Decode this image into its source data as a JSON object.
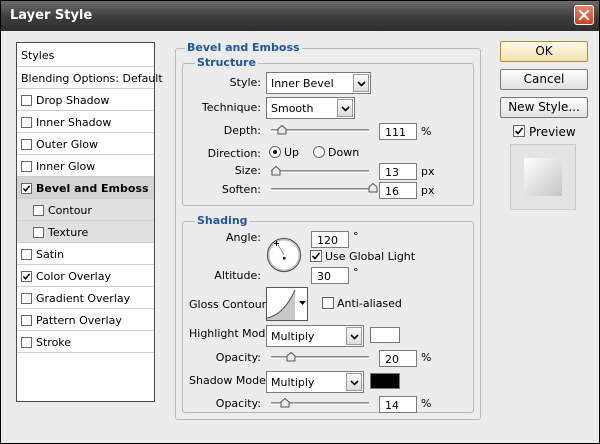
{
  "window": {
    "title": "Layer Style"
  },
  "styles_list": {
    "items": [
      {
        "label": "Styles",
        "has_checkbox": false,
        "checked": false,
        "bold": false
      },
      {
        "label": "Blending Options: Default",
        "has_checkbox": false,
        "checked": false,
        "bold": false
      },
      {
        "label": "Drop Shadow",
        "has_checkbox": true,
        "checked": false,
        "bold": false
      },
      {
        "label": "Inner Shadow",
        "has_checkbox": true,
        "checked": false,
        "bold": false
      },
      {
        "label": "Outer Glow",
        "has_checkbox": true,
        "checked": false,
        "bold": false
      },
      {
        "label": "Inner Glow",
        "has_checkbox": true,
        "checked": false,
        "bold": false
      },
      {
        "label": "Bevel and Emboss",
        "has_checkbox": true,
        "checked": true,
        "bold": true,
        "selected": true
      },
      {
        "label": "Contour",
        "has_checkbox": true,
        "checked": false,
        "bold": false,
        "sub": true
      },
      {
        "label": "Texture",
        "has_checkbox": true,
        "checked": false,
        "bold": false,
        "sub": true
      },
      {
        "label": "Satin",
        "has_checkbox": true,
        "checked": false,
        "bold": false
      },
      {
        "label": "Color Overlay",
        "has_checkbox": true,
        "checked": true,
        "bold": false
      },
      {
        "label": "Gradient Overlay",
        "has_checkbox": true,
        "checked": false,
        "bold": false
      },
      {
        "label": "Pattern Overlay",
        "has_checkbox": true,
        "checked": false,
        "bold": false
      },
      {
        "label": "Stroke",
        "has_checkbox": true,
        "checked": false,
        "bold": false
      }
    ]
  },
  "buttons": {
    "ok": "OK",
    "cancel": "Cancel",
    "new_style": "New Style..."
  },
  "preview": {
    "label": "Preview",
    "checked": true
  },
  "bevel": {
    "section_title": "Bevel and Emboss",
    "structure_title": "Structure",
    "style_label": "Style:",
    "style_value": "Inner Bevel",
    "technique_label": "Technique:",
    "technique_value": "Smooth",
    "depth_label": "Depth:",
    "depth_value": "111",
    "depth_unit": "%",
    "depth_level": 0.11,
    "direction_label": "Direction:",
    "direction_up": "Up",
    "direction_down": "Down",
    "direction_selected": "Up",
    "size_label": "Size:",
    "size_value": "13",
    "size_unit": "px",
    "size_level": 0.05,
    "soften_label": "Soften:",
    "soften_value": "16",
    "soften_unit": "px",
    "soften_level": 1.0
  },
  "shading": {
    "title": "Shading",
    "angle_label": "Angle:",
    "angle_value": "120",
    "angle_unit": "°",
    "global_light_label": "Use Global Light",
    "global_light_checked": true,
    "altitude_label": "Altitude:",
    "altitude_value": "30",
    "altitude_unit": "°",
    "gloss_label": "Gloss Contour:",
    "antialiased_label": "Anti-aliased",
    "antialiased_checked": false,
    "highlight_mode_label": "Highlight Mode:",
    "highlight_mode_value": "Multiply",
    "highlight_color": "#ffffff",
    "highlight_opacity_label": "Opacity:",
    "highlight_opacity_value": "20",
    "highlight_opacity_unit": "%",
    "highlight_opacity_level": 0.2,
    "shadow_mode_label": "Shadow Mode:",
    "shadow_mode_value": "Multiply",
    "shadow_color": "#000000",
    "shadow_opacity_label": "Opacity:",
    "shadow_opacity_value": "14",
    "shadow_opacity_unit": "%",
    "shadow_opacity_level": 0.14
  },
  "icons": {
    "close": "close-icon",
    "dropdown": "chevron-down-icon",
    "checkmark": "checkmark-icon",
    "slider_thumb": "slider-thumb-icon",
    "angle_dial": "angle-dial-icon",
    "gloss_contour": "contour-curve-icon"
  },
  "colors": {
    "accent_blue": "#1f55a5",
    "title_bar": "#3c3c3c",
    "close_red": "#d4532c",
    "ok_button": "#f3e1b0"
  }
}
